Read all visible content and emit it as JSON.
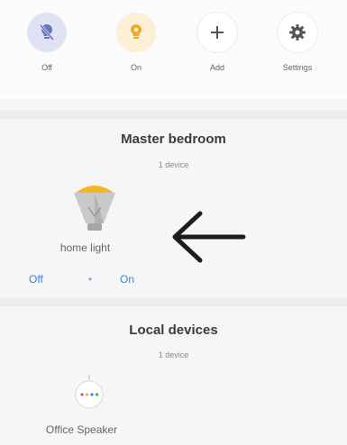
{
  "actions": [
    {
      "label": "Off",
      "icon": "light-off-icon"
    },
    {
      "label": "On",
      "icon": "light-on-icon"
    },
    {
      "label": "Add",
      "icon": "plus-icon"
    },
    {
      "label": "Settings",
      "icon": "gear-icon"
    }
  ],
  "rooms": [
    {
      "title": "Master bedroom",
      "subtitle": "1 device",
      "device": {
        "name": "home light",
        "icon": "bulb-icon",
        "off_label": "Off",
        "separator": "•",
        "on_label": "On"
      }
    },
    {
      "title": "Local devices",
      "subtitle": "1 device",
      "device": {
        "name": "Office Speaker",
        "icon": "speaker-icon"
      }
    }
  ],
  "annotation": {
    "icon": "arrow-left-icon"
  },
  "colors": {
    "accent_blue": "#3f7fe0",
    "off_circle": "#dfe3f4",
    "on_circle": "#fbf0d6",
    "bulb_yellow": "#f4b726"
  }
}
